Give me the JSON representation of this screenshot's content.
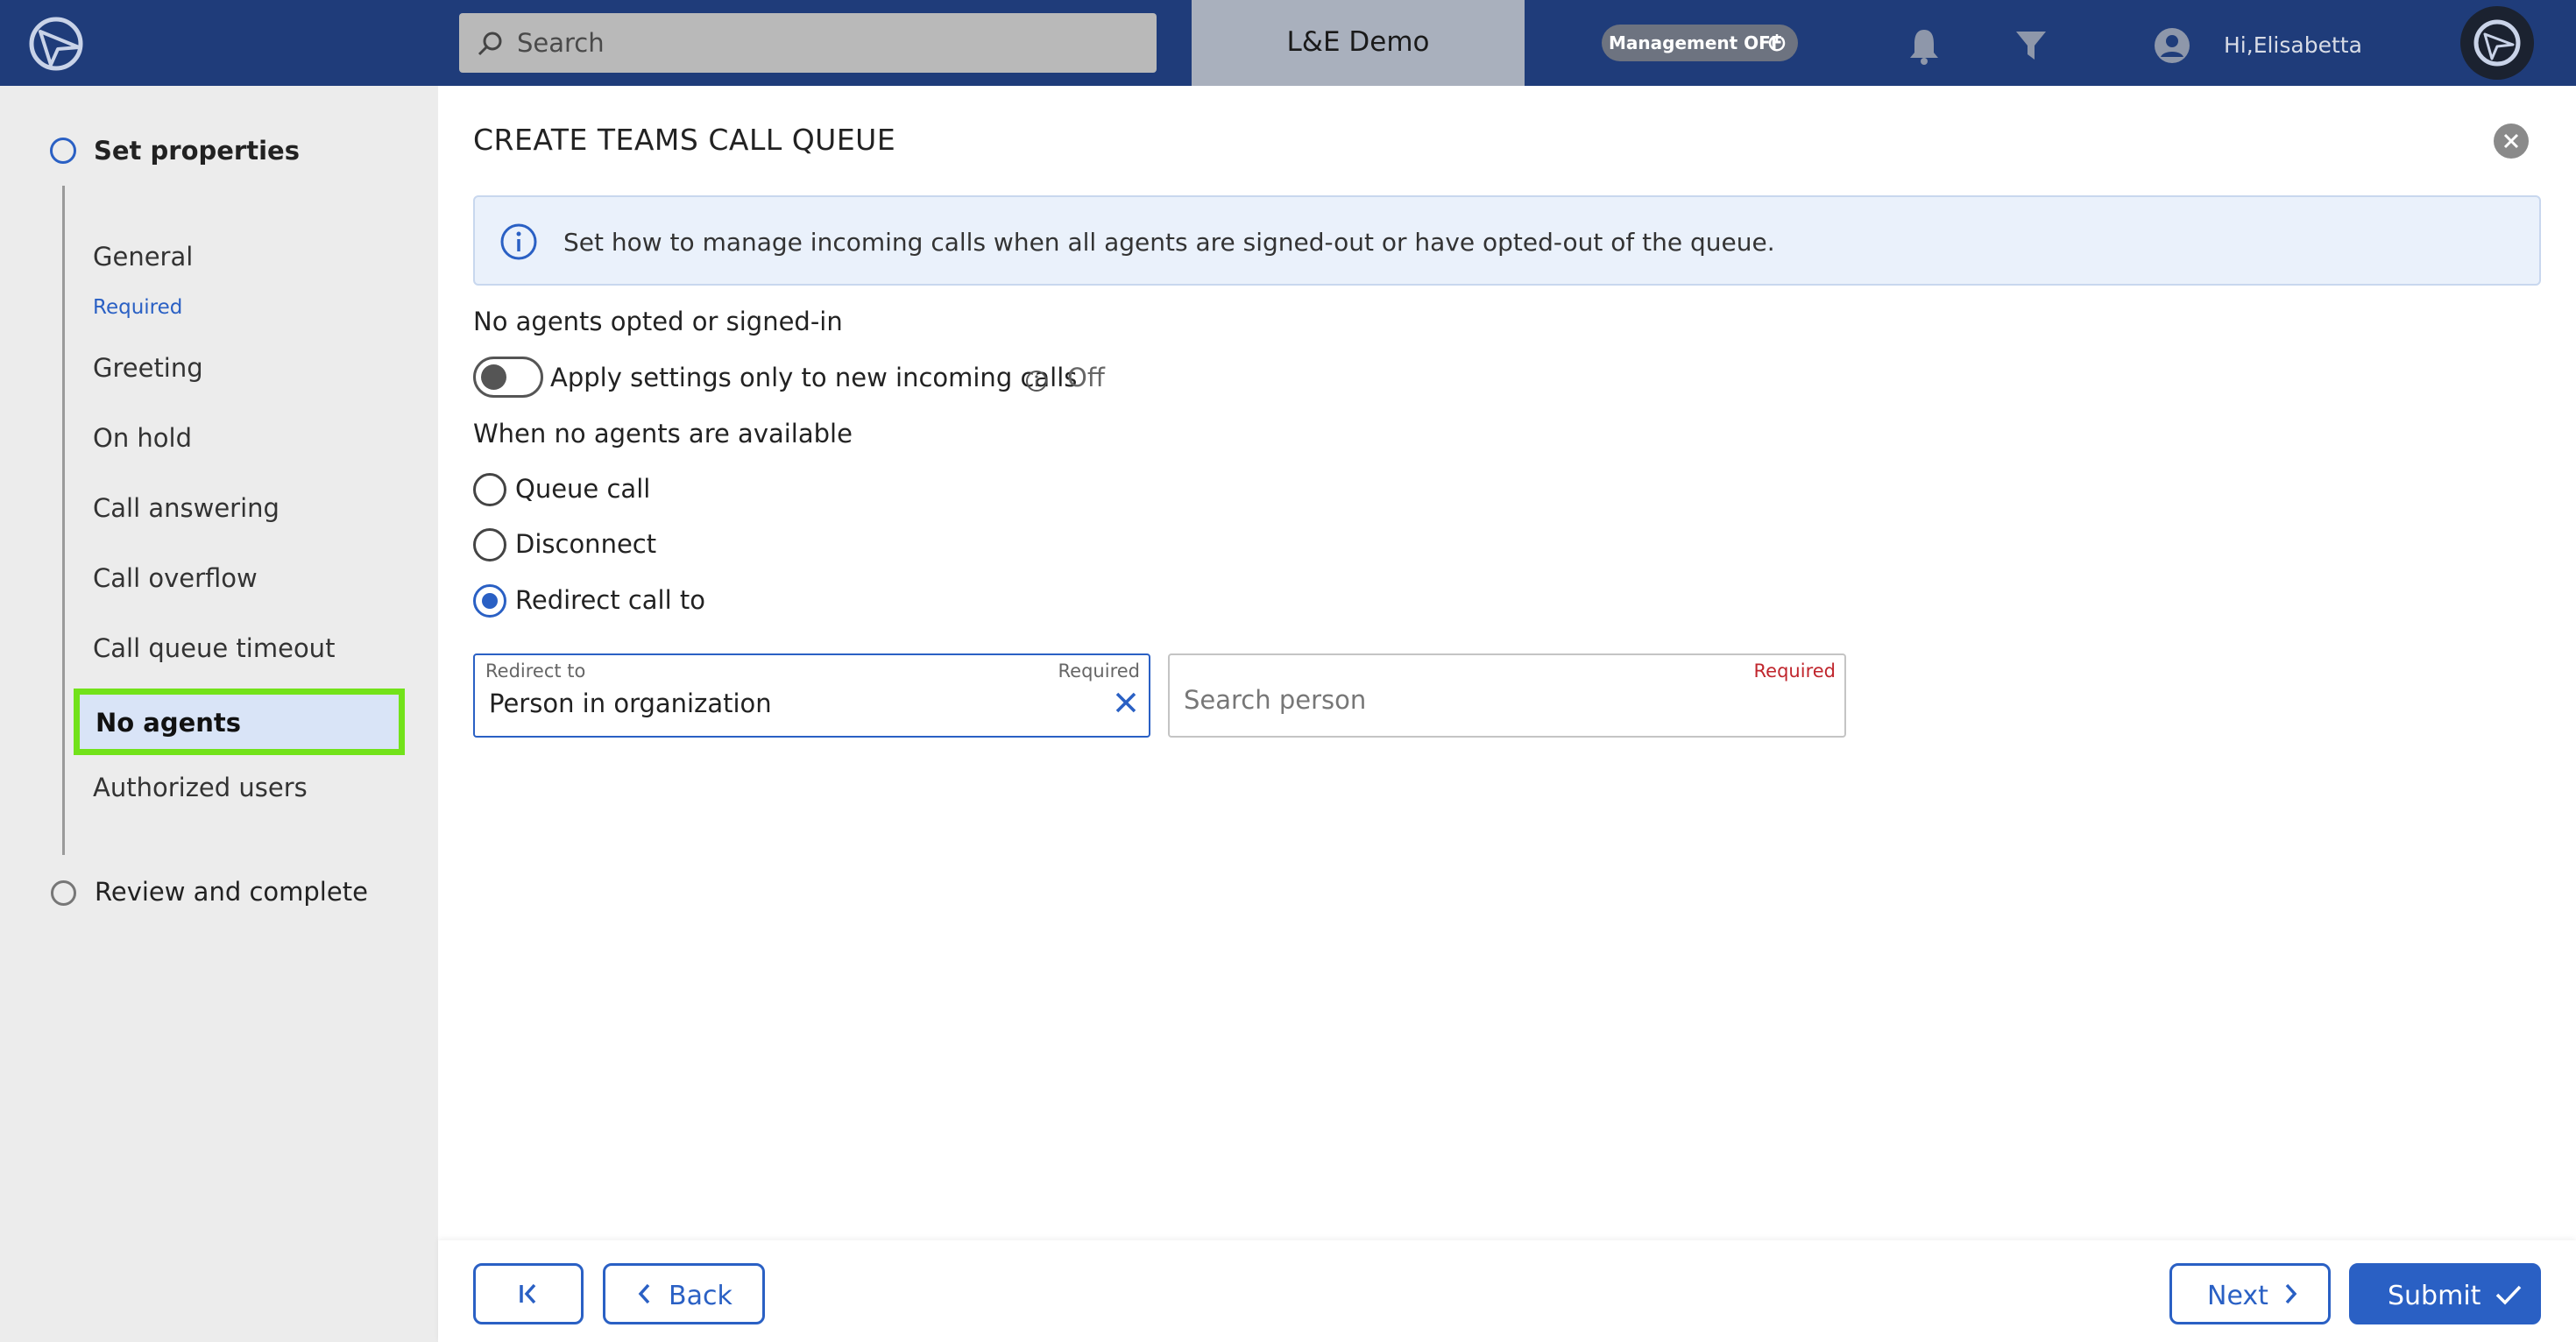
{
  "topbar": {
    "search_placeholder": "Search",
    "tenant": "L&E Demo",
    "management_toggle": "Management OFF",
    "greeting": "Hi,Elisabetta",
    "icons": [
      "app-logo-icon",
      "search-icon",
      "power-icon",
      "bell-icon",
      "filter-icon",
      "user-icon",
      "avatar"
    ],
    "bar_color": "#1f3c7a"
  },
  "sidebar": {
    "step1": "Set properties",
    "items": [
      {
        "label": "General",
        "note": "Required"
      },
      {
        "label": "Greeting"
      },
      {
        "label": "On hold"
      },
      {
        "label": "Call answering"
      },
      {
        "label": "Call overflow"
      },
      {
        "label": "Call queue timeout"
      },
      {
        "label": "No agents",
        "active": true
      },
      {
        "label": "Authorized users"
      }
    ],
    "step2": "Review and complete",
    "highlight_color": "#72e21a"
  },
  "main": {
    "title": "CREATE TEAMS CALL QUEUE",
    "info_text": "Set how to manage incoming calls when all agents are signed-out or have opted-out of the queue.",
    "section1": "No agents opted or signed-in",
    "toggle_label": "Apply settings only to new incoming calls",
    "toggle_state": "Off",
    "section2": "When no agents are available",
    "radios": [
      {
        "label": "Queue call",
        "selected": false
      },
      {
        "label": "Disconnect",
        "selected": false
      },
      {
        "label": "Redirect call to",
        "selected": true
      }
    ],
    "redirect_field": {
      "label": "Redirect to",
      "required": "Required",
      "value": "Person in organization"
    },
    "person_field": {
      "placeholder": "Search person",
      "required": "Required"
    }
  },
  "footer": {
    "first_label": "",
    "back_label": "Back",
    "next_label": "Next",
    "submit_label": "Submit"
  },
  "accent_color": "#2a60c4"
}
